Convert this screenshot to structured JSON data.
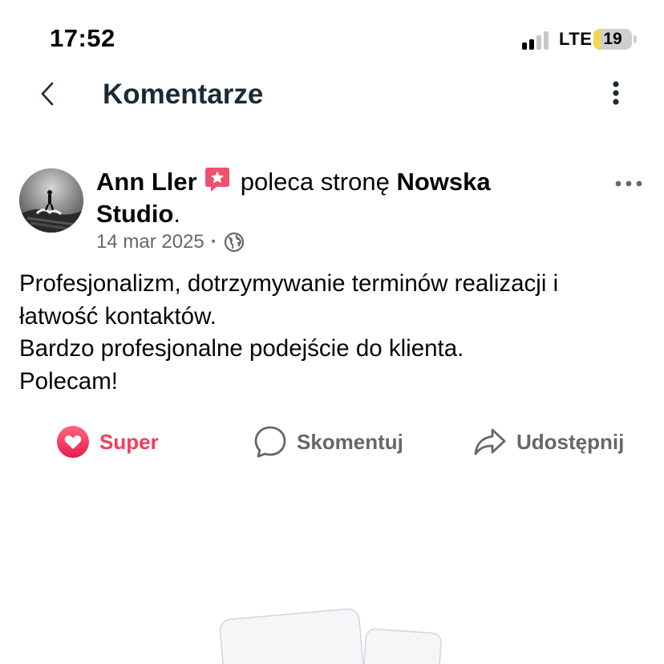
{
  "status_bar": {
    "time": "17:52",
    "network": "LTE",
    "battery": "19",
    "battery_level": 0.19,
    "signal_bars_active": 2,
    "signal_bars_total": 4
  },
  "nav": {
    "back_icon": "chevron-left-icon",
    "title": "Komentarze",
    "more_icon": "vertical-dots-icon"
  },
  "post": {
    "author": "Ann Ller",
    "recommend_icon": "recommendation-star-icon",
    "action_text": "poleca stronę",
    "page_name": "Nowska Studio",
    "period": ".",
    "date": "14 mar 2025",
    "separator": "·",
    "audience_icon": "globe-icon",
    "more_icon": "horizontal-dots-icon",
    "body_lines": [
      "Profesjonalizm, dotrzymywanie terminów realizacji i",
      "łatwość kontaktów.",
      "Bardzo profesjonalne podejście do klienta.",
      "Polecam!"
    ]
  },
  "actions": {
    "super": {
      "label": "Super",
      "icon": "heart-icon",
      "color": "#f33e58"
    },
    "comment": {
      "label": "Skomentuj",
      "icon": "comment-bubble-icon"
    },
    "share": {
      "label": "Udostępnij",
      "icon": "share-arrow-icon"
    }
  },
  "colors": {
    "primary_text": "#050505",
    "secondary_text": "#65676b",
    "title_text": "#1c2b33",
    "reaction": "#f33e58"
  }
}
